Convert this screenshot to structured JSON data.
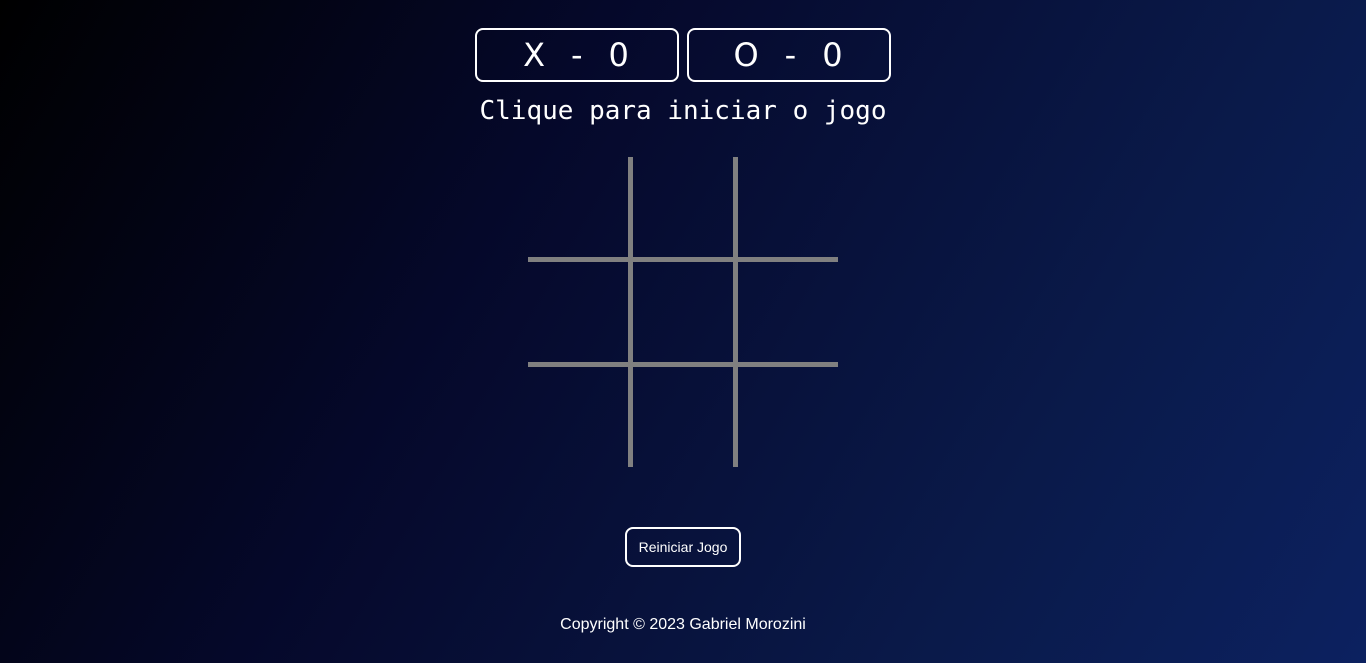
{
  "scoreboard": {
    "x": {
      "player": "X",
      "separator": "-",
      "score": "0"
    },
    "o": {
      "player": "O",
      "separator": "-",
      "score": "0"
    }
  },
  "status_text": "Clique para iniciar o jogo",
  "board": {
    "cells": [
      "",
      "",
      "",
      "",
      "",
      "",
      "",
      "",
      ""
    ],
    "line_color": "#808080"
  },
  "reset_button": {
    "label": "Reiniciar Jogo"
  },
  "footer": {
    "copyright": "Copyright © 2023 Gabriel Morozini"
  },
  "colors": {
    "background_start": "#000000",
    "background_end": "#0c2160",
    "text": "#ffffff"
  }
}
